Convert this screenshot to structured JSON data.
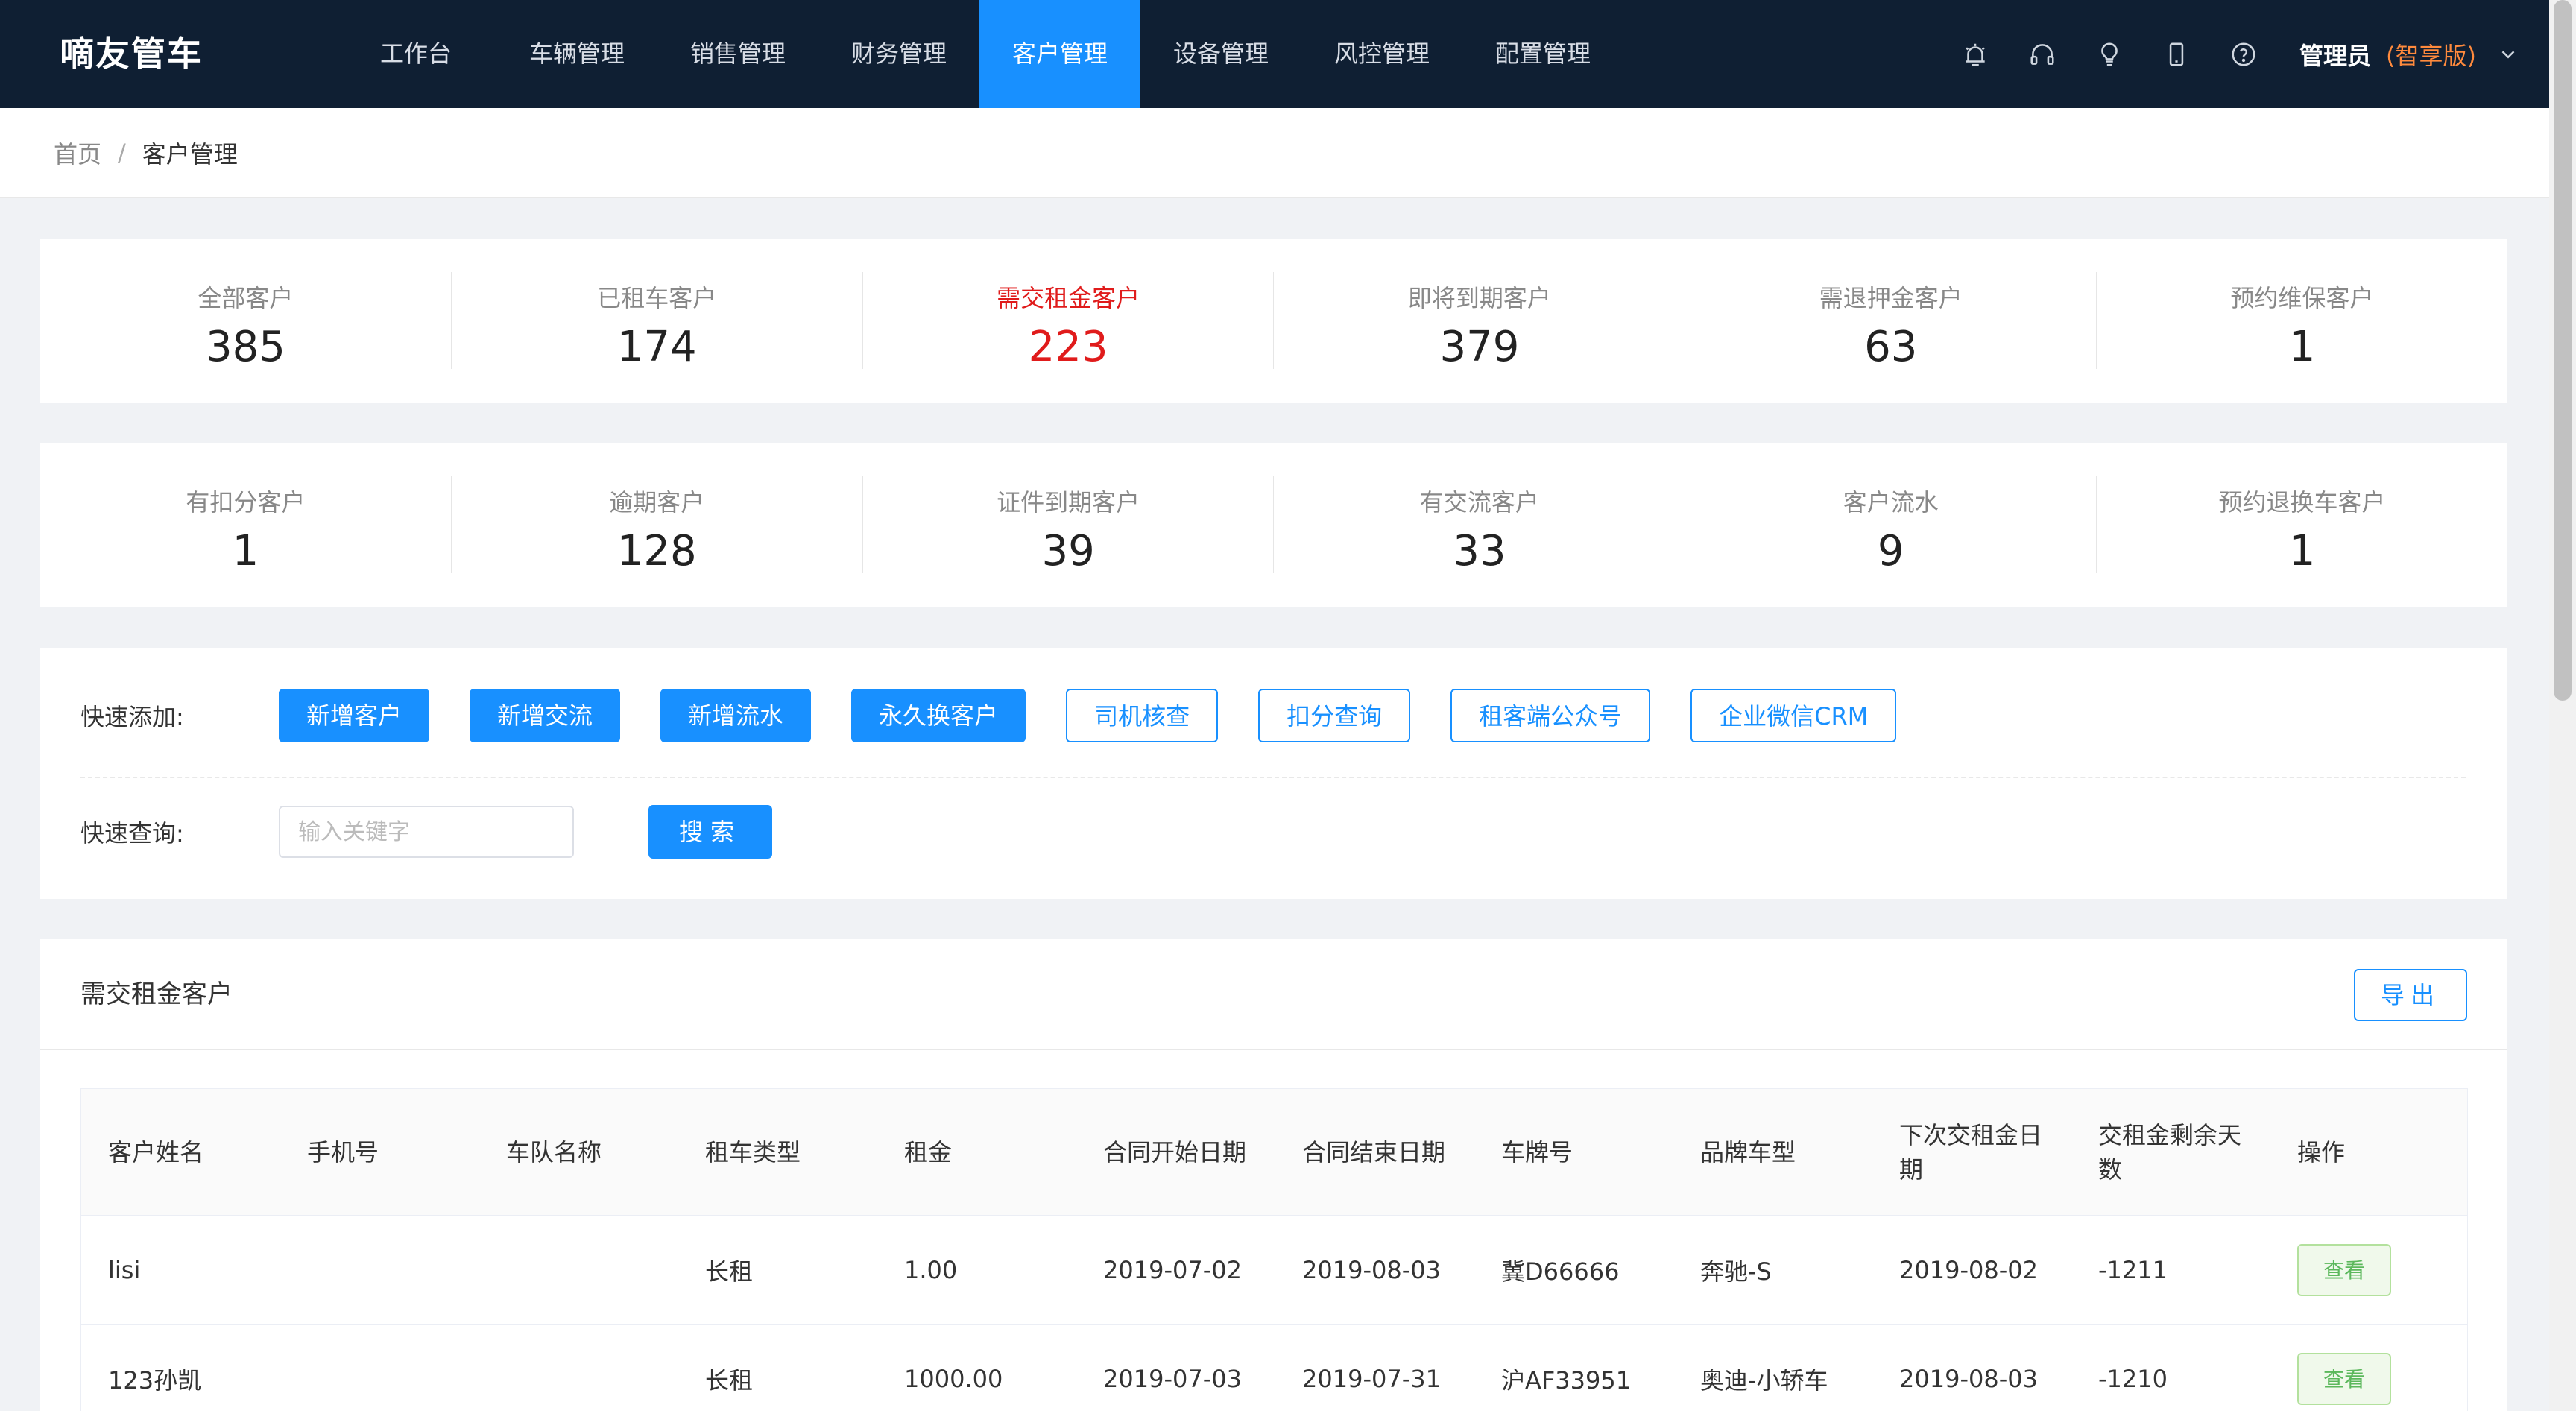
{
  "header": {
    "brand": "嘀友管车",
    "nav": [
      {
        "label": "工作台",
        "active": false
      },
      {
        "label": "车辆管理",
        "active": false
      },
      {
        "label": "销售管理",
        "active": false
      },
      {
        "label": "财务管理",
        "active": false
      },
      {
        "label": "客户管理",
        "active": true
      },
      {
        "label": "设备管理",
        "active": false
      },
      {
        "label": "风控管理",
        "active": false
      },
      {
        "label": "配置管理",
        "active": false
      }
    ],
    "icons": [
      "alarm-icon",
      "headset-icon",
      "lightbulb-icon",
      "mobile-icon",
      "help-icon"
    ],
    "user": "管理员",
    "edition": "(智享版)"
  },
  "breadcrumb": {
    "home": "首页",
    "separator": "/",
    "current": "客户管理"
  },
  "stats_row1": [
    {
      "label": "全部客户",
      "value": "385"
    },
    {
      "label": "已租车客户",
      "value": "174"
    },
    {
      "label": "需交租金客户",
      "value": "223",
      "highlight": true
    },
    {
      "label": "即将到期客户",
      "value": "379"
    },
    {
      "label": "需退押金客户",
      "value": "63"
    },
    {
      "label": "预约维保客户",
      "value": "1"
    }
  ],
  "stats_row2": [
    {
      "label": "有扣分客户",
      "value": "1"
    },
    {
      "label": "逾期客户",
      "value": "128"
    },
    {
      "label": "证件到期客户",
      "value": "39"
    },
    {
      "label": "有交流客户",
      "value": "33"
    },
    {
      "label": "客户流水",
      "value": "9"
    },
    {
      "label": "预约退换车客户",
      "value": "1"
    }
  ],
  "quick": {
    "add_label": "快速添加:",
    "add_buttons": [
      {
        "label": "新增客户",
        "style": "solid"
      },
      {
        "label": "新增交流",
        "style": "solid"
      },
      {
        "label": "新增流水",
        "style": "solid"
      },
      {
        "label": "永久换客户",
        "style": "solid"
      },
      {
        "label": "司机核查",
        "style": "ghost"
      },
      {
        "label": "扣分查询",
        "style": "ghost"
      },
      {
        "label": "租客端公众号",
        "style": "ghost"
      },
      {
        "label": "企业微信CRM",
        "style": "ghost"
      }
    ],
    "search_label": "快速查询:",
    "search_placeholder": "输入关键字",
    "search_value": "",
    "search_button": "搜索"
  },
  "table_panel": {
    "title": "需交租金客户",
    "export_label": "导出",
    "columns": [
      "客户姓名",
      "手机号",
      "车队名称",
      "租车类型",
      "租金",
      "合同开始日期",
      "合同结束日期",
      "车牌号",
      "品牌车型",
      "下次交租金日期",
      "交租金剩余天数",
      "操作"
    ],
    "rows": [
      [
        "lisi",
        "",
        "",
        "长租",
        "1.00",
        "2019-07-02",
        "2019-08-03",
        "冀D66666",
        "奔驰-S",
        "2019-08-02",
        "-1211",
        "查看"
      ],
      [
        "123孙凯",
        "",
        "",
        "长租",
        "1000.00",
        "2019-07-03",
        "2019-07-31",
        "沪AF33951",
        "奥迪-小轿车",
        "2019-08-03",
        "-1210",
        "查看"
      ]
    ]
  },
  "colors": {
    "header_bg": "#0f1f33",
    "accent": "#1890ff",
    "highlight": "#e01b1b",
    "edition": "#ff8a3d"
  }
}
